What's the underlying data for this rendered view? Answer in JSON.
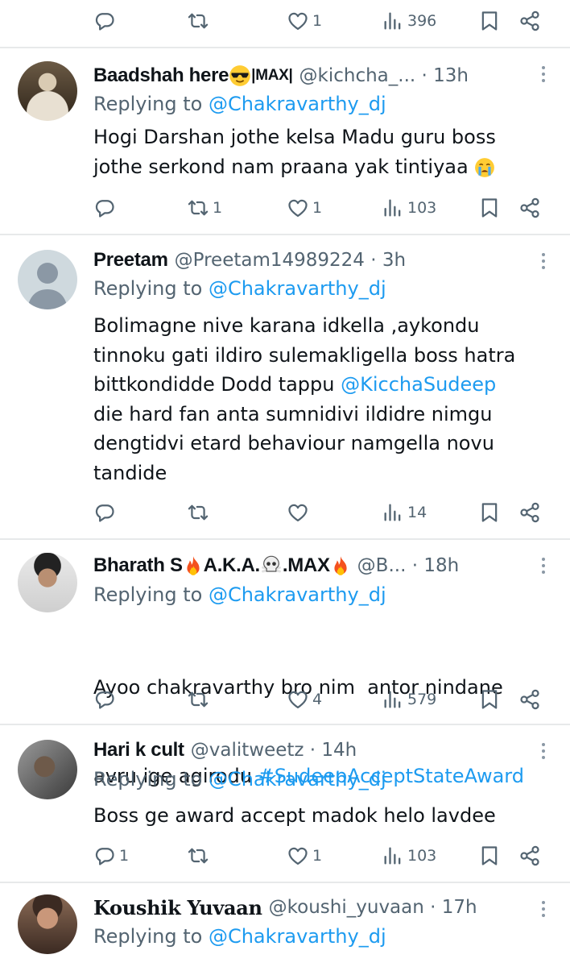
{
  "top_actions": {
    "reply_count": "",
    "retweet_count": "",
    "like_count": "1",
    "view_count": "396"
  },
  "tweets": [
    {
      "name": "Baadshah here",
      "name_suffix": "|MAX|",
      "handle": "@kichcha_... · 13h",
      "replying_prefix": "Replying to",
      "replying_to": "@Chakravarthy_dj",
      "text_lines": [
        "Hogi Darshan jothe kelsa Madu guru boss",
        "jothe serkond nam praana yak tintiyaa"
      ],
      "reply_count": "",
      "retweet_count": "1",
      "like_count": "1",
      "view_count": "103"
    },
    {
      "name": "Preetam",
      "handle": "@Preetam14989224 · 3h",
      "replying_prefix": "Replying to",
      "replying_to": "@Chakravarthy_dj",
      "text_lines": [
        "Bolimagne nive karana idkella ,aykondu",
        "tinnoku gati ildiro sulemakligella boss hatra",
        "bittkondidde Dodd tappu ",
        "die hard fan anta sumnidivi ildidre nimgu",
        "dengtidvi etard behaviour namgella novu",
        "tandide"
      ],
      "mention": "@KicchaSudeep",
      "reply_count": "",
      "retweet_count": "",
      "like_count": "",
      "view_count": "14"
    },
    {
      "name_parts": [
        "Bharath S ",
        "A.K.A.",
        ".MAX"
      ],
      "handle": "@B... · 18h",
      "replying_prefix": "Replying to",
      "replying_to": "@Chakravarthy_dj",
      "text_lines": [
        "Ayoo chakravarthy bro nim  antor nindane",
        "avru ige agirodu "
      ],
      "hashtag": "#SudeepAcceptStateAward",
      "reply_count": "",
      "retweet_count": "",
      "like_count": "4",
      "view_count": "579"
    },
    {
      "name": "Hari k cult",
      "handle": "@valitweetz · 14h",
      "replying_prefix": "Replying to",
      "replying_to": "@Chakravarthy_dj",
      "text_lines": [
        "Boss ge award accept madok helo lavdee"
      ],
      "reply_count": "1",
      "retweet_count": "",
      "like_count": "1",
      "view_count": "103"
    },
    {
      "name": "Koushik Yuvaan",
      "handle": "@koushi_yuvaan · 17h",
      "replying_prefix": "Replying to",
      "replying_to": "@Chakravarthy_dj"
    }
  ],
  "colors": {
    "link": "#1d9bf0",
    "secondary_text": "#536471",
    "divider": "#e7e9ea"
  },
  "icons": [
    "reply-icon",
    "retweet-icon",
    "like-icon",
    "views-icon",
    "bookmark-icon",
    "share-icon",
    "more-icon",
    "sunglasses-emoji",
    "crying-emoji",
    "fire-emoji",
    "skull-crossbones-emoji"
  ]
}
